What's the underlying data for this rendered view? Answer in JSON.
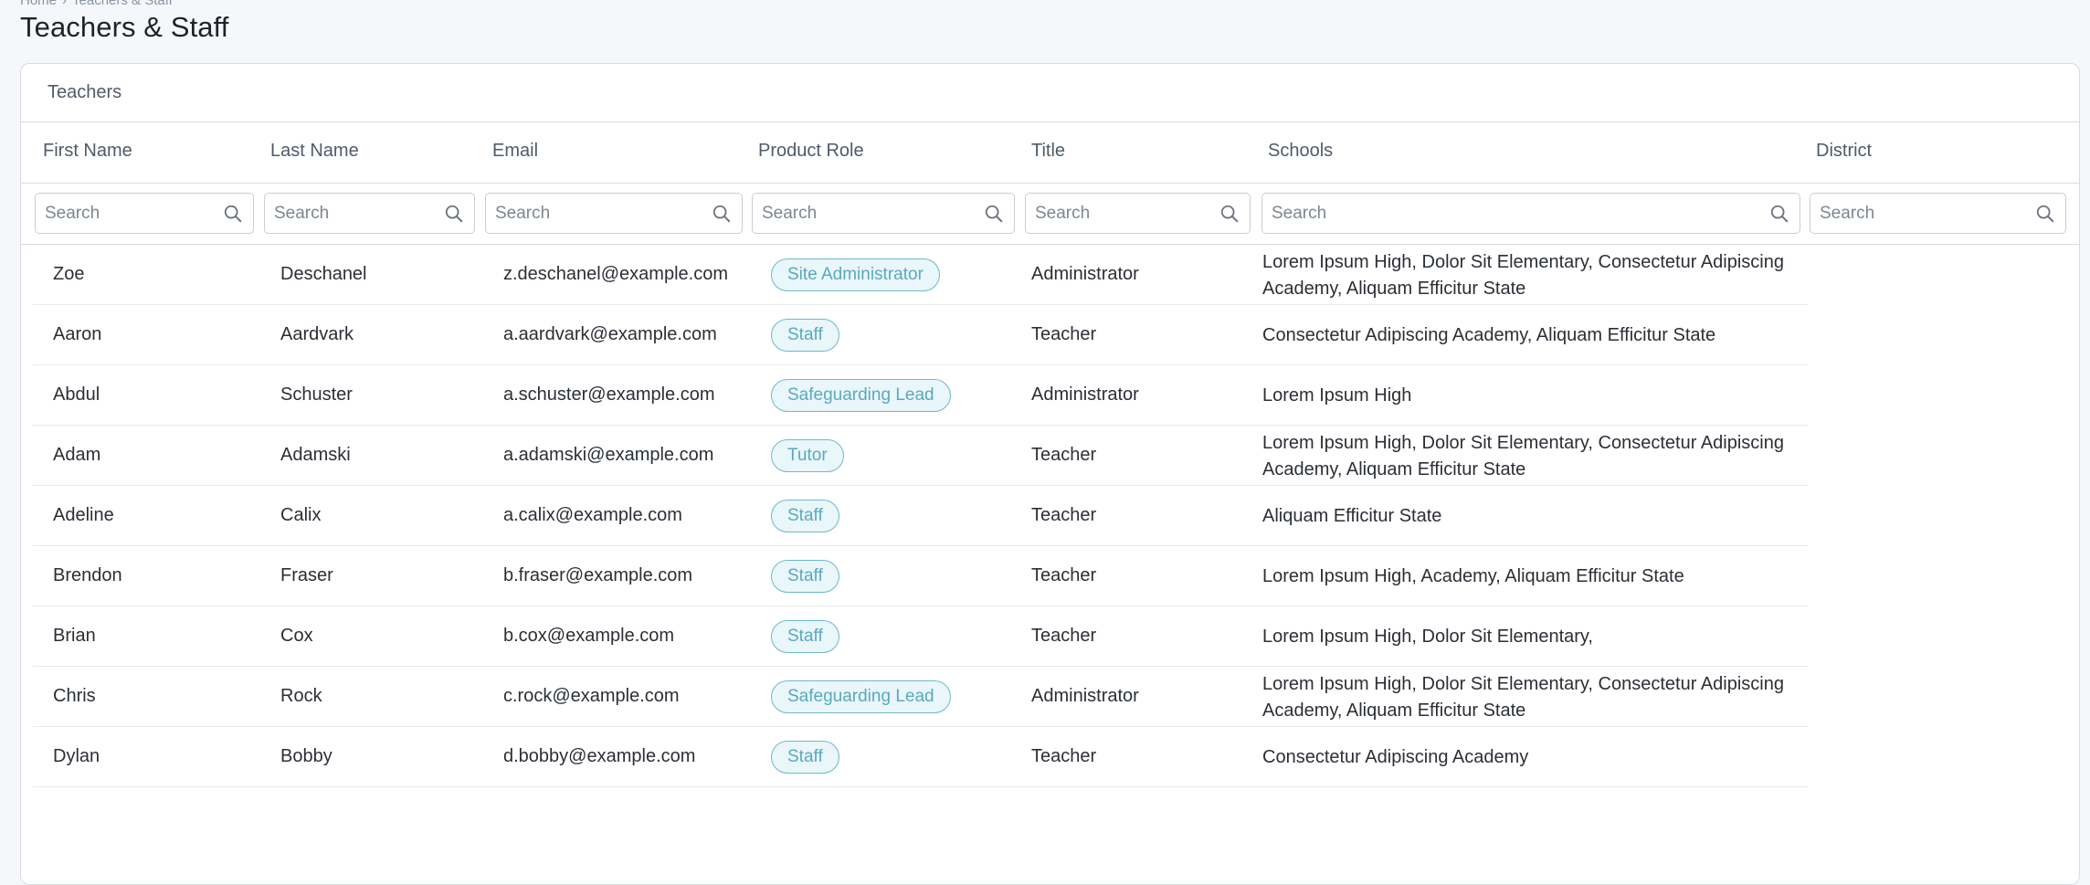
{
  "breadcrumb": [
    "Home",
    "Teachers & Staff"
  ],
  "page_title": "Teachers & Staff",
  "panel_title": "Teachers",
  "columns": [
    "First Name",
    "Last Name",
    "Email",
    "Product Role",
    "Title",
    "Schools",
    "District"
  ],
  "search_placeholder": "Search",
  "rows": [
    {
      "first": "Zoe",
      "last": "Deschanel",
      "email": "z.deschanel@example.com",
      "role": "Site Administrator",
      "title": "Administrator",
      "schools": "Lorem Ipsum High, Dolor Sit Elementary, Consectetur Adipiscing Academy, Aliquam Efficitur State"
    },
    {
      "first": "Aaron",
      "last": "Aardvark",
      "email": "a.aardvark@example.com",
      "role": "Staff",
      "title": "Teacher",
      "schools": "Consectetur Adipiscing  Academy, Aliquam Efficitur State"
    },
    {
      "first": "Abdul",
      "last": "Schuster",
      "email": "a.schuster@example.com",
      "role": "Safeguarding Lead",
      "title": "Administrator",
      "schools": "Lorem Ipsum High"
    },
    {
      "first": "Adam",
      "last": "Adamski",
      "email": "a.adamski@example.com",
      "role": "Tutor",
      "title": "Teacher",
      "schools": "Lorem Ipsum High, Dolor Sit Elementary, Consectetur Adipiscing Academy, Aliquam Efficitur State"
    },
    {
      "first": "Adeline",
      "last": "Calix",
      "email": "a.calix@example.com",
      "role": "Staff",
      "title": "Teacher",
      "schools": "Aliquam Efficitur State"
    },
    {
      "first": "Brendon",
      "last": "Fraser",
      "email": "b.fraser@example.com",
      "role": "Staff",
      "title": "Teacher",
      "schools": "Lorem Ipsum High, Academy, Aliquam Efficitur State"
    },
    {
      "first": "Brian",
      "last": "Cox",
      "email": "b.cox@example.com",
      "role": "Staff",
      "title": "Teacher",
      "schools": "Lorem Ipsum High, Dolor Sit Elementary,"
    },
    {
      "first": "Chris",
      "last": "Rock",
      "email": "c.rock@example.com",
      "role": "Safeguarding Lead",
      "title": "Administrator",
      "schools": "Lorem Ipsum High, Dolor Sit Elementary, Consectetur Adipiscing Academy, Aliquam Efficitur State"
    },
    {
      "first": "Dylan",
      "last": "Bobby",
      "email": "d.bobby@example.com",
      "role": "Staff",
      "title": "Teacher",
      "schools": "Consectetur Adipiscing  Academy"
    }
  ],
  "colors": {
    "pill_border": "#6fb7c9",
    "pill_background": "#e9f6fa",
    "pill_text": "#5aa9bd"
  },
  "icons": {
    "search": "search-icon"
  }
}
